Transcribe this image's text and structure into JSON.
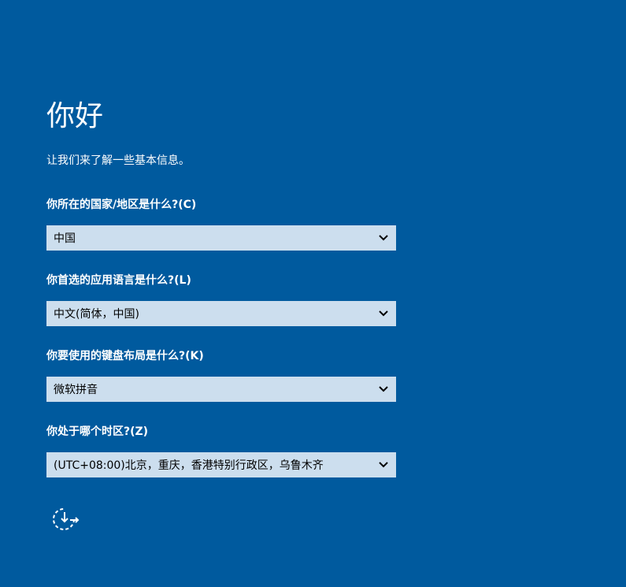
{
  "header": {
    "title": "你好",
    "subtitle": "让我们来了解一些基本信息。"
  },
  "region": {
    "question": "你所在的国家/地区是什么?(C)",
    "value": "中国"
  },
  "language": {
    "question": "你首选的应用语言是什么?(L)",
    "value": "中文(简体，中国)"
  },
  "keyboard": {
    "question": "你要使用的键盘布局是什么?(K)",
    "value": "微软拼音"
  },
  "timezone": {
    "question": "你处于哪个时区?(Z)",
    "value": "(UTC+08:00)北京，重庆，香港特别行政区，乌鲁木齐"
  },
  "icons": {
    "dropdown": "chevron-down-icon",
    "accessibility": "ease-of-access-icon"
  },
  "colors": {
    "background": "#005a9e",
    "select_background": "#ccdeee",
    "text": "#ffffff"
  }
}
